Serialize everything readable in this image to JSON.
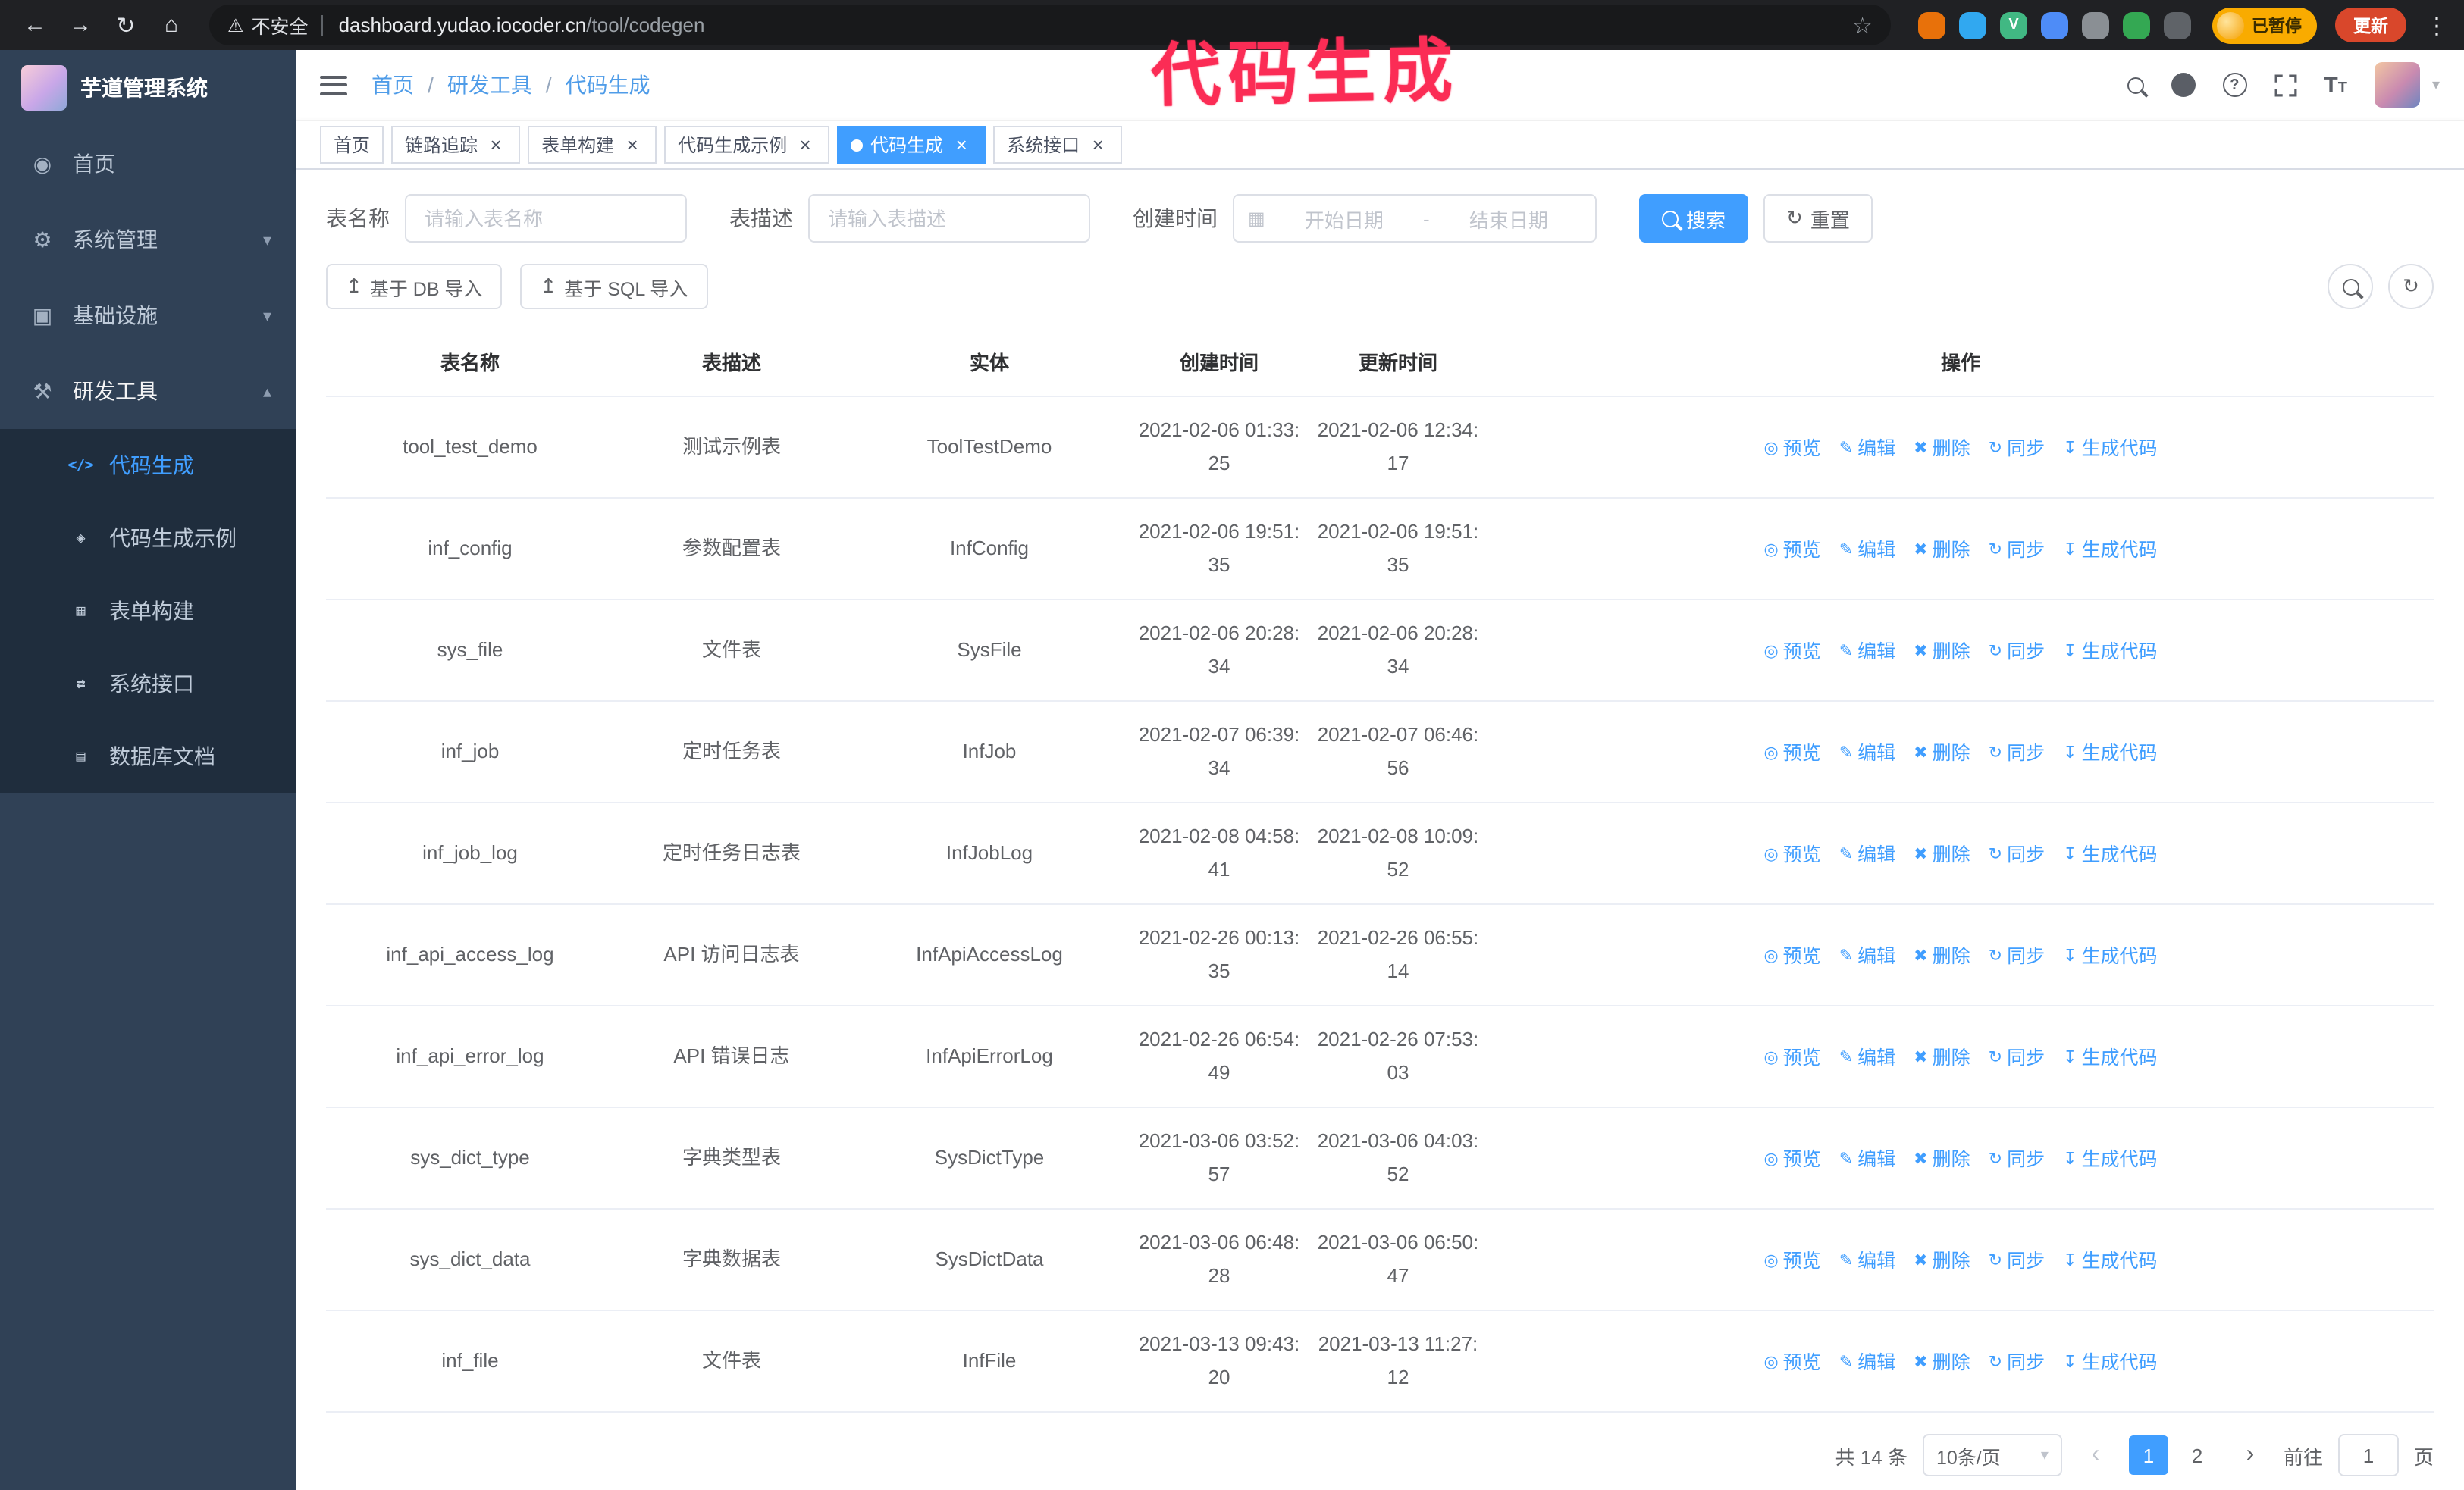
{
  "colors": {
    "accent": "#409eff",
    "sidebar_bg": "#304156",
    "submenu_bg": "#1f2d3d",
    "chrome_bg": "#202124",
    "annotation": "#fb2c55",
    "paused_badge_bg": "#f9ab00",
    "update_button_bg": "#d9472b"
  },
  "annotation": {
    "text": "代码生成"
  },
  "browser": {
    "security_label": "不安全",
    "url_host": "dashboard.yudao.iocoder.cn",
    "url_path": "/tool/codegen",
    "paused_badge": "已暂停",
    "update_button": "更新",
    "extensions": [
      {
        "name": "orange-extension-icon",
        "color": "#e8710a",
        "glyph": ""
      },
      {
        "name": "blue-drop-extension-icon",
        "color": "#31a8f0",
        "glyph": ""
      },
      {
        "name": "vue-devtools-extension-icon",
        "color": "#41b883",
        "glyph": "V"
      },
      {
        "name": "people-extension-icon",
        "color": "#4e8cf7",
        "glyph": ""
      },
      {
        "name": "gray-extension-icon",
        "color": "#8a8f94",
        "glyph": ""
      },
      {
        "name": "green-extension-icon",
        "color": "#34a853",
        "glyph": ""
      },
      {
        "name": "puzzle-extension-icon",
        "color": "#5f6368",
        "glyph": ""
      }
    ]
  },
  "sidebar": {
    "logo_title": "芋道管理系统",
    "items": [
      {
        "label": "首页",
        "icon": "dashboard-icon"
      },
      {
        "label": "系统管理",
        "icon": "gear-icon",
        "chevron": "chevron-down-icon"
      },
      {
        "label": "基础设施",
        "icon": "monitor-icon",
        "chevron": "chevron-down-icon"
      },
      {
        "label": "研发工具",
        "icon": "tools-icon",
        "chevron": "chevron-up-icon",
        "expanded": true
      }
    ],
    "sub_items": [
      {
        "label": "代码生成",
        "icon": "code-icon",
        "active": true
      },
      {
        "label": "代码生成示例",
        "icon": "example-icon"
      },
      {
        "label": "表单构建",
        "icon": "form-builder-icon"
      },
      {
        "label": "系统接口",
        "icon": "api-icon"
      },
      {
        "label": "数据库文档",
        "icon": "database-doc-icon"
      }
    ]
  },
  "header": {
    "breadcrumb": [
      "首页",
      "研发工具",
      "代码生成"
    ]
  },
  "tabs": [
    {
      "label": "首页",
      "closable": false,
      "active": false
    },
    {
      "label": "链路追踪",
      "closable": true,
      "active": false
    },
    {
      "label": "表单构建",
      "closable": true,
      "active": false
    },
    {
      "label": "代码生成示例",
      "closable": true,
      "active": false
    },
    {
      "label": "代码生成",
      "closable": true,
      "active": true
    },
    {
      "label": "系统接口",
      "closable": true,
      "active": false
    }
  ],
  "filters": {
    "table_name_label": "表名称",
    "table_name_placeholder": "请输入表名称",
    "table_desc_label": "表描述",
    "table_desc_placeholder": "请输入表描述",
    "create_time_label": "创建时间",
    "date_start_placeholder": "开始日期",
    "date_separator": "-",
    "date_end_placeholder": "结束日期",
    "search_button": "搜索",
    "reset_button": "重置"
  },
  "toolbar": {
    "import_db_button": "基于 DB 导入",
    "import_sql_button": "基于 SQL 导入"
  },
  "table": {
    "columns": [
      "表名称",
      "表描述",
      "实体",
      "创建时间",
      "更新时间",
      "操作"
    ],
    "actions": [
      {
        "label": "预览",
        "icon": "eye-icon"
      },
      {
        "label": "编辑",
        "icon": "edit-icon"
      },
      {
        "label": "删除",
        "icon": "delete-icon"
      },
      {
        "label": "同步",
        "icon": "sync-icon"
      },
      {
        "label": "生成代码",
        "icon": "download-icon"
      }
    ],
    "rows": [
      {
        "name": "tool_test_demo",
        "desc": "测试示例表",
        "entity": "ToolTestDemo",
        "created": "2021-02-06 01:33:25",
        "updated": "2021-02-06 12:34:17"
      },
      {
        "name": "inf_config",
        "desc": "参数配置表",
        "entity": "InfConfig",
        "created": "2021-02-06 19:51:35",
        "updated": "2021-02-06 19:51:35"
      },
      {
        "name": "sys_file",
        "desc": "文件表",
        "entity": "SysFile",
        "created": "2021-02-06 20:28:34",
        "updated": "2021-02-06 20:28:34"
      },
      {
        "name": "inf_job",
        "desc": "定时任务表",
        "entity": "InfJob",
        "created": "2021-02-07 06:39:34",
        "updated": "2021-02-07 06:46:56"
      },
      {
        "name": "inf_job_log",
        "desc": "定时任务日志表",
        "entity": "InfJobLog",
        "created": "2021-02-08 04:58:41",
        "updated": "2021-02-08 10:09:52"
      },
      {
        "name": "inf_api_access_log",
        "desc": "API 访问日志表",
        "entity": "InfApiAccessLog",
        "created": "2021-02-26 00:13:35",
        "updated": "2021-02-26 06:55:14"
      },
      {
        "name": "inf_api_error_log",
        "desc": "API 错误日志",
        "entity": "InfApiErrorLog",
        "created": "2021-02-26 06:54:49",
        "updated": "2021-02-26 07:53:03"
      },
      {
        "name": "sys_dict_type",
        "desc": "字典类型表",
        "entity": "SysDictType",
        "created": "2021-03-06 03:52:57",
        "updated": "2021-03-06 04:03:52"
      },
      {
        "name": "sys_dict_data",
        "desc": "字典数据表",
        "entity": "SysDictData",
        "created": "2021-03-06 06:48:28",
        "updated": "2021-03-06 06:50:47"
      },
      {
        "name": "inf_file",
        "desc": "文件表",
        "entity": "InfFile",
        "created": "2021-03-13 09:43:20",
        "updated": "2021-03-13 11:27:12"
      }
    ]
  },
  "pagination": {
    "total_text": "共 14 条",
    "page_size_value": "10条/页",
    "pages": [
      {
        "label": "1",
        "active": true
      },
      {
        "label": "2",
        "active": false
      }
    ],
    "goto_label": "前往",
    "goto_value": "1",
    "goto_unit": "页"
  },
  "icons": {
    "dashboard-icon": "◉",
    "gear-icon": "⚙",
    "monitor-icon": "▣",
    "tools-icon": "⚒",
    "chevron-down-icon": "▾",
    "chevron-up-icon": "▴",
    "code-icon": "</>",
    "example-icon": "◈",
    "form-builder-icon": "▦",
    "api-icon": "⇄",
    "database-doc-icon": "▤",
    "eye-icon": "◎",
    "edit-icon": "✎",
    "delete-icon": "✖",
    "sync-icon": "↻",
    "download-icon": "↧",
    "upload-icon": "↥",
    "calendar-icon": "▦",
    "refresh-icon": "↻",
    "close-icon": "×",
    "caret-down-icon": "▾",
    "back-icon": "←",
    "forward-icon": "→",
    "reload-icon": "↻",
    "home-icon": "⌂",
    "star-icon": "☆",
    "warning-icon": "⚠",
    "kebab-icon": "⋮",
    "prev-icon": "‹",
    "next-icon": "›",
    "help-icon": "?"
  }
}
